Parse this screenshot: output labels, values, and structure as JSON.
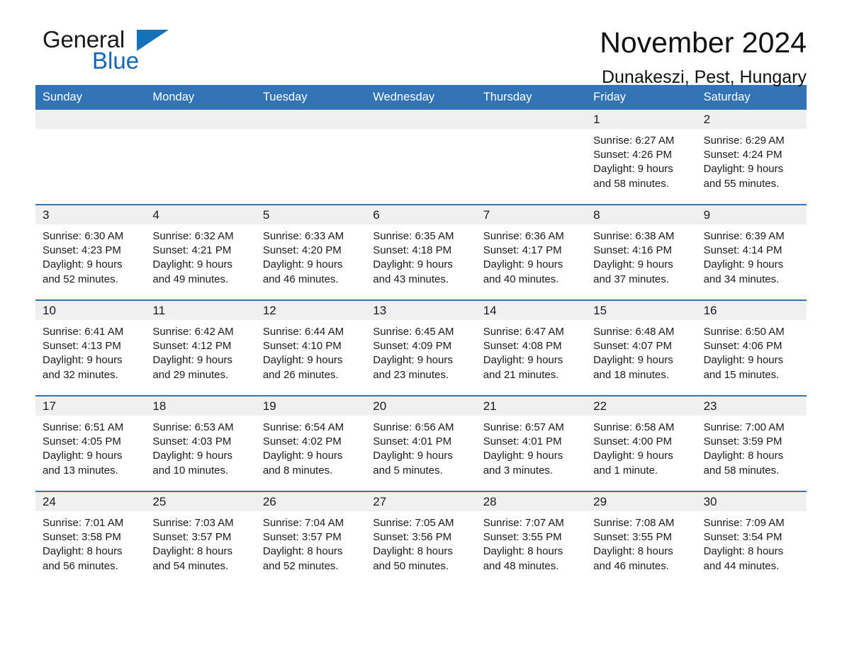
{
  "brand": {
    "name_part1": "General",
    "name_part2": "Blue",
    "triangle_icon": "triangle-logo-icon",
    "accent_color": "#1472b8"
  },
  "header": {
    "title": "November 2024",
    "location": "Dunakeszi, Pest, Hungary"
  },
  "theme": {
    "header_blue": "#3173b4",
    "daynum_band": "#f0f0f0",
    "text": "#1a1a1a"
  },
  "weekdays": [
    "Sunday",
    "Monday",
    "Tuesday",
    "Wednesday",
    "Thursday",
    "Friday",
    "Saturday"
  ],
  "weeks": [
    [
      {
        "day": "",
        "empty": true,
        "sunrise": "",
        "sunset": "",
        "daylight1": "",
        "daylight2": ""
      },
      {
        "day": "",
        "empty": true,
        "sunrise": "",
        "sunset": "",
        "daylight1": "",
        "daylight2": ""
      },
      {
        "day": "",
        "empty": true,
        "sunrise": "",
        "sunset": "",
        "daylight1": "",
        "daylight2": ""
      },
      {
        "day": "",
        "empty": true,
        "sunrise": "",
        "sunset": "",
        "daylight1": "",
        "daylight2": ""
      },
      {
        "day": "",
        "empty": true,
        "sunrise": "",
        "sunset": "",
        "daylight1": "",
        "daylight2": ""
      },
      {
        "day": "1",
        "empty": false,
        "sunrise": "Sunrise: 6:27 AM",
        "sunset": "Sunset: 4:26 PM",
        "daylight1": "Daylight: 9 hours",
        "daylight2": "and 58 minutes."
      },
      {
        "day": "2",
        "empty": false,
        "sunrise": "Sunrise: 6:29 AM",
        "sunset": "Sunset: 4:24 PM",
        "daylight1": "Daylight: 9 hours",
        "daylight2": "and 55 minutes."
      }
    ],
    [
      {
        "day": "3",
        "empty": false,
        "sunrise": "Sunrise: 6:30 AM",
        "sunset": "Sunset: 4:23 PM",
        "daylight1": "Daylight: 9 hours",
        "daylight2": "and 52 minutes."
      },
      {
        "day": "4",
        "empty": false,
        "sunrise": "Sunrise: 6:32 AM",
        "sunset": "Sunset: 4:21 PM",
        "daylight1": "Daylight: 9 hours",
        "daylight2": "and 49 minutes."
      },
      {
        "day": "5",
        "empty": false,
        "sunrise": "Sunrise: 6:33 AM",
        "sunset": "Sunset: 4:20 PM",
        "daylight1": "Daylight: 9 hours",
        "daylight2": "and 46 minutes."
      },
      {
        "day": "6",
        "empty": false,
        "sunrise": "Sunrise: 6:35 AM",
        "sunset": "Sunset: 4:18 PM",
        "daylight1": "Daylight: 9 hours",
        "daylight2": "and 43 minutes."
      },
      {
        "day": "7",
        "empty": false,
        "sunrise": "Sunrise: 6:36 AM",
        "sunset": "Sunset: 4:17 PM",
        "daylight1": "Daylight: 9 hours",
        "daylight2": "and 40 minutes."
      },
      {
        "day": "8",
        "empty": false,
        "sunrise": "Sunrise: 6:38 AM",
        "sunset": "Sunset: 4:16 PM",
        "daylight1": "Daylight: 9 hours",
        "daylight2": "and 37 minutes."
      },
      {
        "day": "9",
        "empty": false,
        "sunrise": "Sunrise: 6:39 AM",
        "sunset": "Sunset: 4:14 PM",
        "daylight1": "Daylight: 9 hours",
        "daylight2": "and 34 minutes."
      }
    ],
    [
      {
        "day": "10",
        "empty": false,
        "sunrise": "Sunrise: 6:41 AM",
        "sunset": "Sunset: 4:13 PM",
        "daylight1": "Daylight: 9 hours",
        "daylight2": "and 32 minutes."
      },
      {
        "day": "11",
        "empty": false,
        "sunrise": "Sunrise: 6:42 AM",
        "sunset": "Sunset: 4:12 PM",
        "daylight1": "Daylight: 9 hours",
        "daylight2": "and 29 minutes."
      },
      {
        "day": "12",
        "empty": false,
        "sunrise": "Sunrise: 6:44 AM",
        "sunset": "Sunset: 4:10 PM",
        "daylight1": "Daylight: 9 hours",
        "daylight2": "and 26 minutes."
      },
      {
        "day": "13",
        "empty": false,
        "sunrise": "Sunrise: 6:45 AM",
        "sunset": "Sunset: 4:09 PM",
        "daylight1": "Daylight: 9 hours",
        "daylight2": "and 23 minutes."
      },
      {
        "day": "14",
        "empty": false,
        "sunrise": "Sunrise: 6:47 AM",
        "sunset": "Sunset: 4:08 PM",
        "daylight1": "Daylight: 9 hours",
        "daylight2": "and 21 minutes."
      },
      {
        "day": "15",
        "empty": false,
        "sunrise": "Sunrise: 6:48 AM",
        "sunset": "Sunset: 4:07 PM",
        "daylight1": "Daylight: 9 hours",
        "daylight2": "and 18 minutes."
      },
      {
        "day": "16",
        "empty": false,
        "sunrise": "Sunrise: 6:50 AM",
        "sunset": "Sunset: 4:06 PM",
        "daylight1": "Daylight: 9 hours",
        "daylight2": "and 15 minutes."
      }
    ],
    [
      {
        "day": "17",
        "empty": false,
        "sunrise": "Sunrise: 6:51 AM",
        "sunset": "Sunset: 4:05 PM",
        "daylight1": "Daylight: 9 hours",
        "daylight2": "and 13 minutes."
      },
      {
        "day": "18",
        "empty": false,
        "sunrise": "Sunrise: 6:53 AM",
        "sunset": "Sunset: 4:03 PM",
        "daylight1": "Daylight: 9 hours",
        "daylight2": "and 10 minutes."
      },
      {
        "day": "19",
        "empty": false,
        "sunrise": "Sunrise: 6:54 AM",
        "sunset": "Sunset: 4:02 PM",
        "daylight1": "Daylight: 9 hours",
        "daylight2": "and 8 minutes."
      },
      {
        "day": "20",
        "empty": false,
        "sunrise": "Sunrise: 6:56 AM",
        "sunset": "Sunset: 4:01 PM",
        "daylight1": "Daylight: 9 hours",
        "daylight2": "and 5 minutes."
      },
      {
        "day": "21",
        "empty": false,
        "sunrise": "Sunrise: 6:57 AM",
        "sunset": "Sunset: 4:01 PM",
        "daylight1": "Daylight: 9 hours",
        "daylight2": "and 3 minutes."
      },
      {
        "day": "22",
        "empty": false,
        "sunrise": "Sunrise: 6:58 AM",
        "sunset": "Sunset: 4:00 PM",
        "daylight1": "Daylight: 9 hours",
        "daylight2": "and 1 minute."
      },
      {
        "day": "23",
        "empty": false,
        "sunrise": "Sunrise: 7:00 AM",
        "sunset": "Sunset: 3:59 PM",
        "daylight1": "Daylight: 8 hours",
        "daylight2": "and 58 minutes."
      }
    ],
    [
      {
        "day": "24",
        "empty": false,
        "sunrise": "Sunrise: 7:01 AM",
        "sunset": "Sunset: 3:58 PM",
        "daylight1": "Daylight: 8 hours",
        "daylight2": "and 56 minutes."
      },
      {
        "day": "25",
        "empty": false,
        "sunrise": "Sunrise: 7:03 AM",
        "sunset": "Sunset: 3:57 PM",
        "daylight1": "Daylight: 8 hours",
        "daylight2": "and 54 minutes."
      },
      {
        "day": "26",
        "empty": false,
        "sunrise": "Sunrise: 7:04 AM",
        "sunset": "Sunset: 3:57 PM",
        "daylight1": "Daylight: 8 hours",
        "daylight2": "and 52 minutes."
      },
      {
        "day": "27",
        "empty": false,
        "sunrise": "Sunrise: 7:05 AM",
        "sunset": "Sunset: 3:56 PM",
        "daylight1": "Daylight: 8 hours",
        "daylight2": "and 50 minutes."
      },
      {
        "day": "28",
        "empty": false,
        "sunrise": "Sunrise: 7:07 AM",
        "sunset": "Sunset: 3:55 PM",
        "daylight1": "Daylight: 8 hours",
        "daylight2": "and 48 minutes."
      },
      {
        "day": "29",
        "empty": false,
        "sunrise": "Sunrise: 7:08 AM",
        "sunset": "Sunset: 3:55 PM",
        "daylight1": "Daylight: 8 hours",
        "daylight2": "and 46 minutes."
      },
      {
        "day": "30",
        "empty": false,
        "sunrise": "Sunrise: 7:09 AM",
        "sunset": "Sunset: 3:54 PM",
        "daylight1": "Daylight: 8 hours",
        "daylight2": "and 44 minutes."
      }
    ]
  ]
}
